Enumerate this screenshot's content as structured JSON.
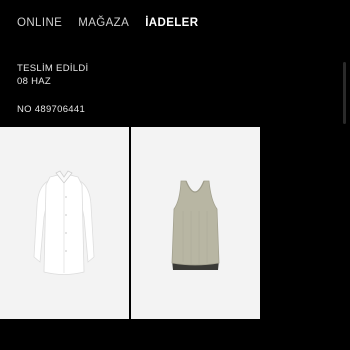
{
  "tabs": [
    {
      "label": "ONLINE",
      "active": false
    },
    {
      "label": "MAĞAZA",
      "active": false
    },
    {
      "label": "İADELER",
      "active": true
    }
  ],
  "order": {
    "status": "TESLİM EDİLDİ",
    "date": "08 HAZ",
    "number": "NO 489706441"
  },
  "products": [
    {
      "icon": "white-shirt-image"
    },
    {
      "icon": "beige-tank-top-image"
    }
  ]
}
